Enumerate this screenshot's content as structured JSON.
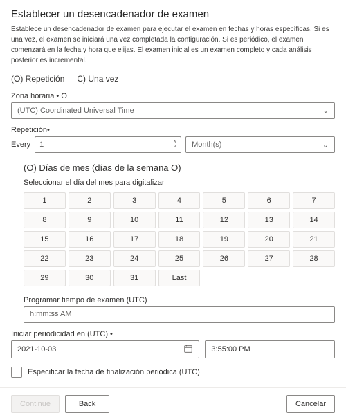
{
  "title": "Establecer un desencadenador de examen",
  "description": "Establece un desencadenador de examen para ejecutar el examen en fechas y horas específicas. Si es una vez, el examen se iniciará una vez completada la configuración. Si es periódico, el examen comenzará en la fecha y hora que elijas. El examen inicial es un examen completo y cada análisis posterior es incremental.",
  "pattern": {
    "recurring": "(O) Repetición",
    "once": "C) Una vez"
  },
  "timezone": {
    "label": "Zona horaria • O",
    "value": "(UTC) Coordinated Universal Time"
  },
  "recur": {
    "heading": "Repetición•",
    "every": "Every",
    "count": "1",
    "unit": "Month(s)"
  },
  "days": {
    "toggle": "(O) Días de mes (días de la semana O)",
    "hint": "Seleccionar el día del mes para digitalizar",
    "cells": [
      "1",
      "2",
      "3",
      "4",
      "5",
      "6",
      "7",
      "8",
      "9",
      "10",
      "11",
      "12",
      "13",
      "14",
      "15",
      "16",
      "17",
      "18",
      "19",
      "20",
      "21",
      "22",
      "23",
      "24",
      "25",
      "26",
      "27",
      "28",
      "29",
      "30",
      "31",
      "Last"
    ]
  },
  "scanTime": {
    "label": "Programar tiempo de examen (UTC)",
    "placeholder": "h:mm:ss AM"
  },
  "start": {
    "label": "Iniciar periodicidad en (UTC) •",
    "date": "2021-10-03",
    "time": "3:55:00 PM"
  },
  "endCheckbox": "Especificar la fecha de finalización periódica (UTC)",
  "buttons": {
    "continue": "Continue",
    "back": "Back",
    "cancel": "Cancelar"
  }
}
